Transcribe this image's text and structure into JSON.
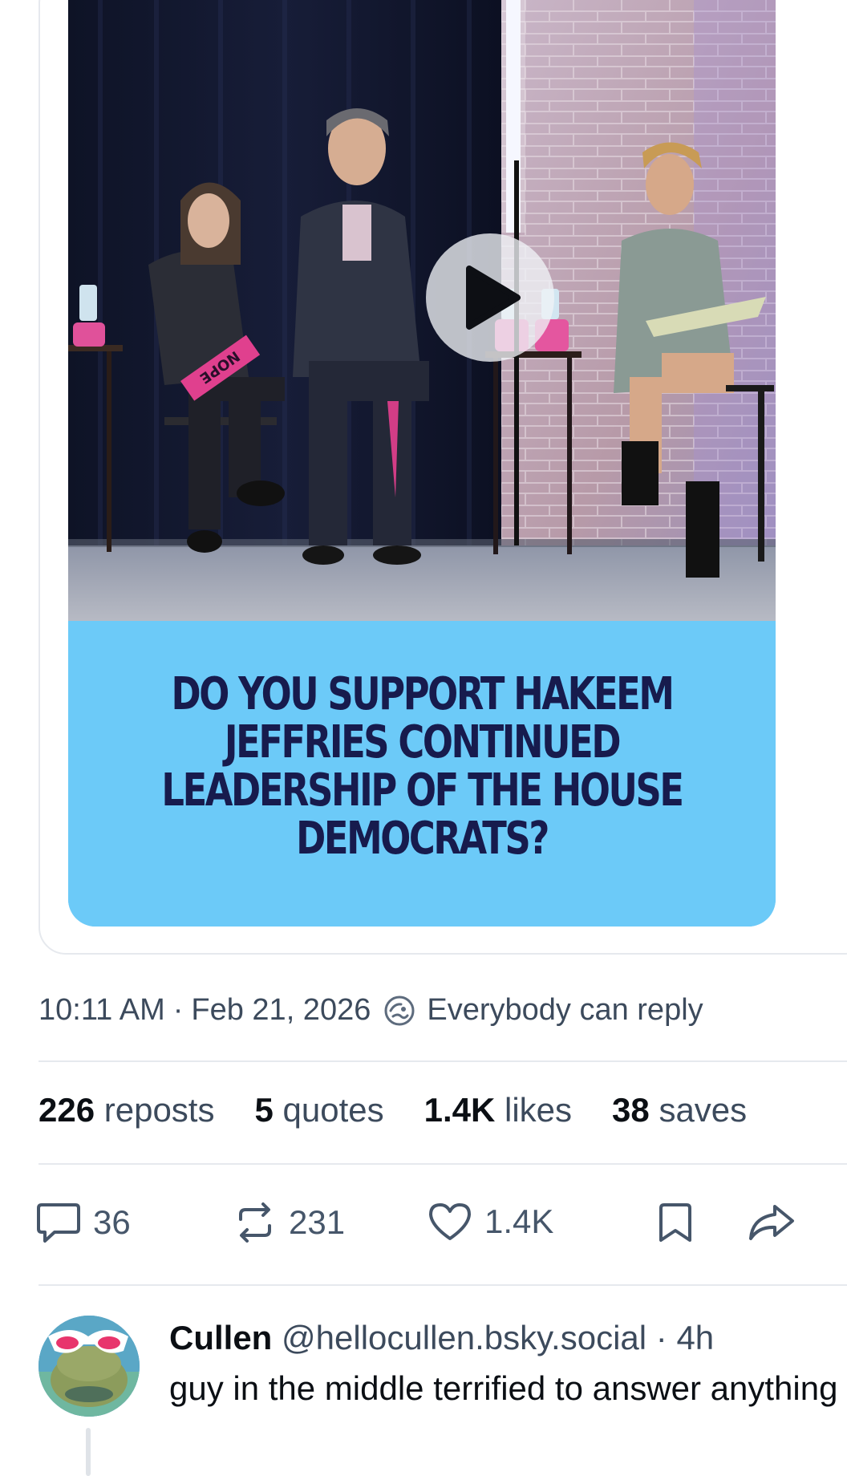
{
  "post": {
    "video_caption": "DO YOU SUPPORT HAKEEM JEFFRIES CONTINUED LEADERSHIP OF THE HOUSE DEMOCRATS?",
    "sign_text": "NOPE",
    "time": "10:11 AM",
    "separator": "·",
    "date": "Feb 21, 2026",
    "reply_setting": "Everybody can reply",
    "stats": {
      "reposts": {
        "count": "226",
        "label": "reposts"
      },
      "quotes": {
        "count": "5",
        "label": "quotes"
      },
      "likes": {
        "count": "1.4K",
        "label": "likes"
      },
      "saves": {
        "count": "38",
        "label": "saves"
      }
    },
    "actions": {
      "replies": "36",
      "reposts": "231",
      "likes": "1.4K"
    }
  },
  "reply": {
    "author": "Cullen",
    "handle": "@hellocullen.bsky.social",
    "separator": "·",
    "time": "4h",
    "text": "guy in the middle terrified to answer anything"
  },
  "colors": {
    "caption_bg": "#6ccaf8",
    "caption_text": "#171b4d",
    "muted_text": "#3c4a5c",
    "divider": "#e6e9ee"
  }
}
